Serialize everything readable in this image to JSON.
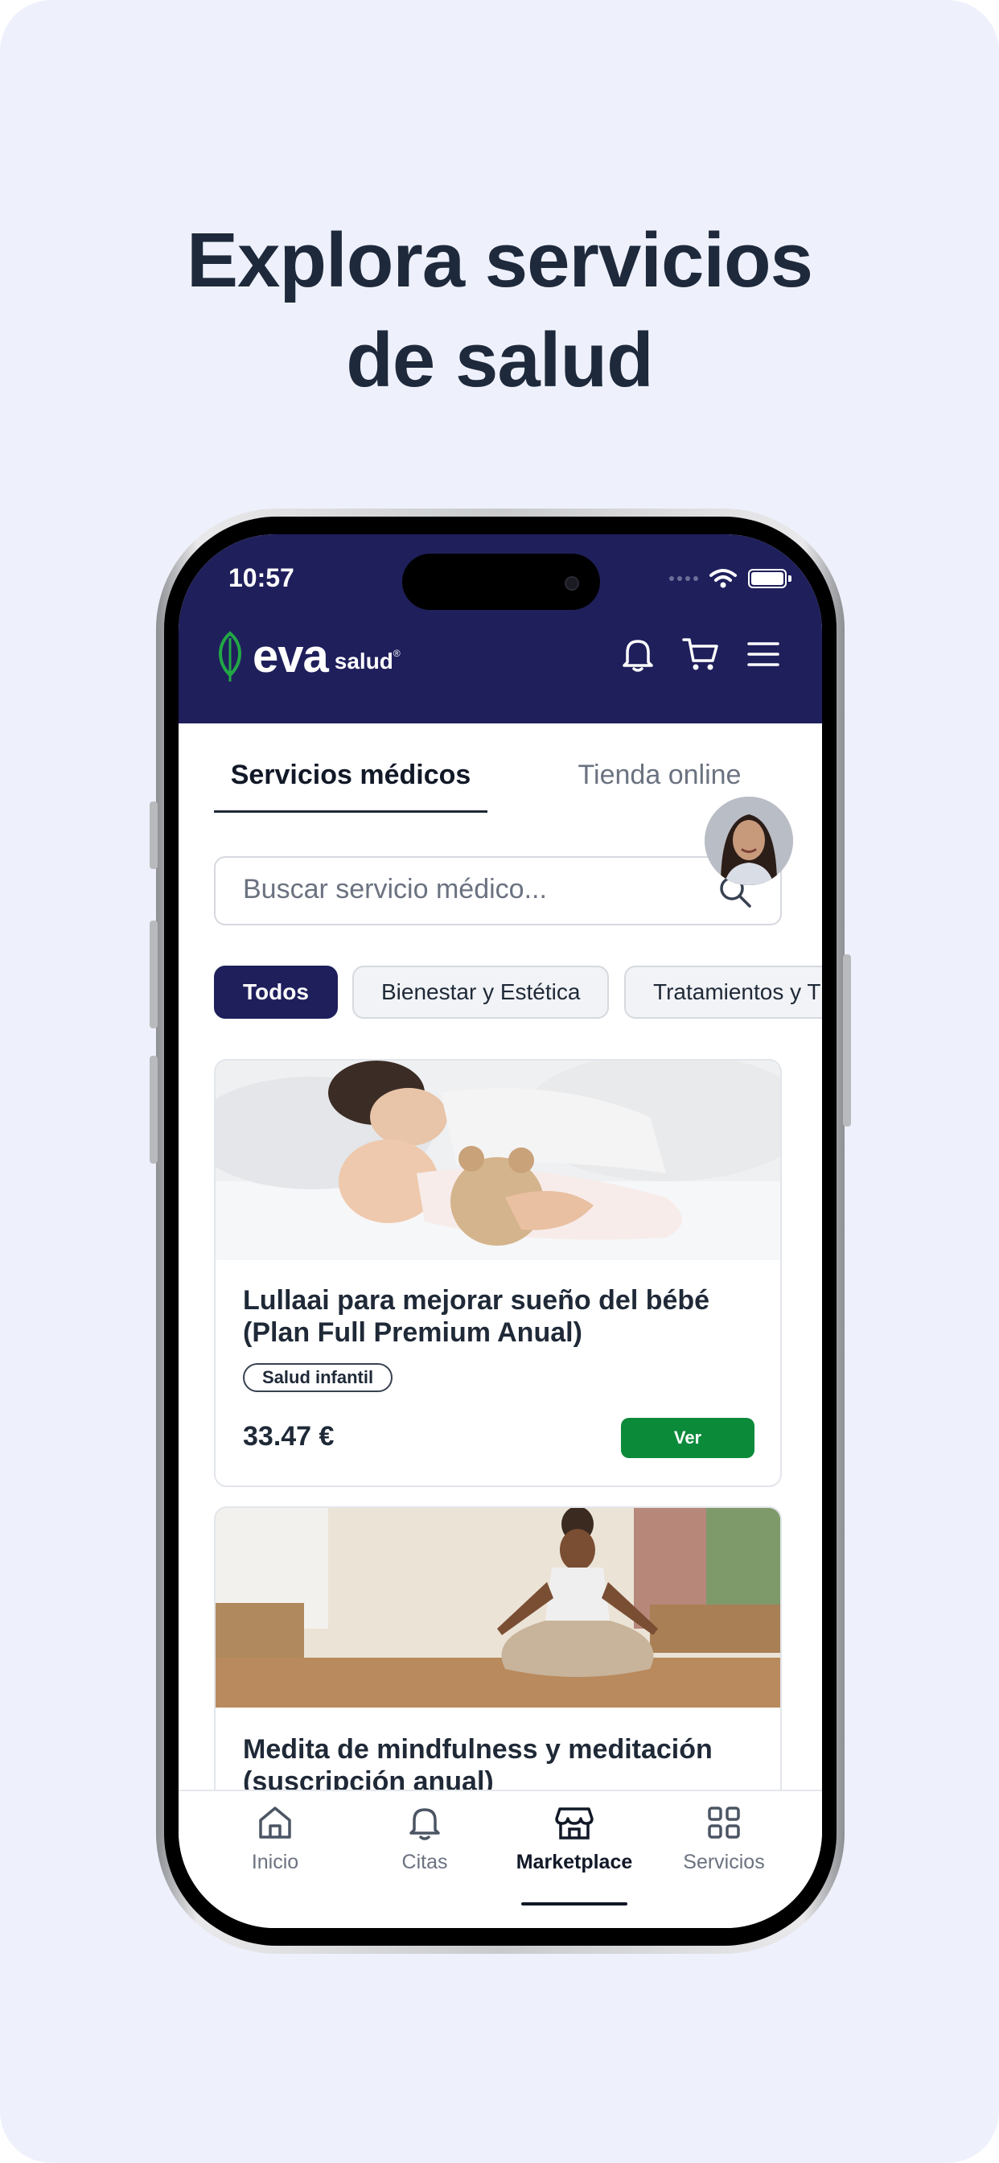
{
  "headline": {
    "line1": "Explora servicios",
    "line2": "de salud"
  },
  "status_bar": {
    "time": "10:57"
  },
  "brand": {
    "name": "eva",
    "sub": "salud",
    "reg": "®"
  },
  "header_icons": [
    "bell-icon",
    "cart-icon",
    "menu-icon"
  ],
  "tabs": [
    {
      "label": "Servicios médicos",
      "active": true
    },
    {
      "label": "Tienda online",
      "active": false
    }
  ],
  "search": {
    "placeholder": "Buscar servicio médico..."
  },
  "chips": [
    {
      "label": "Todos",
      "active": true
    },
    {
      "label": "Bienestar y Estética",
      "active": false
    },
    {
      "label": "Tratamientos y T",
      "active": false
    }
  ],
  "products": [
    {
      "title_line1": "Lullaai para mejorar sueño del bébé",
      "title_line2": "(Plan Full Premium Anual)",
      "tag": "Salud infantil",
      "price": "33.47 €",
      "cta": "Ver"
    },
    {
      "title_line1": "Medita de mindfulness y meditación",
      "title_line2": "(suscripción anual)"
    }
  ],
  "bottom_nav": [
    {
      "label": "Inicio",
      "icon": "home-icon",
      "active": false
    },
    {
      "label": "Citas",
      "icon": "bell-icon",
      "active": false
    },
    {
      "label": "Marketplace",
      "icon": "store-icon",
      "active": true
    },
    {
      "label": "Servicios",
      "icon": "grid-icon",
      "active": false
    }
  ],
  "colors": {
    "page_bg": "#eef1fc",
    "header_bg": "#1f1f5c",
    "accent_green": "#0b8a3a",
    "text_dark": "#1f2937"
  }
}
